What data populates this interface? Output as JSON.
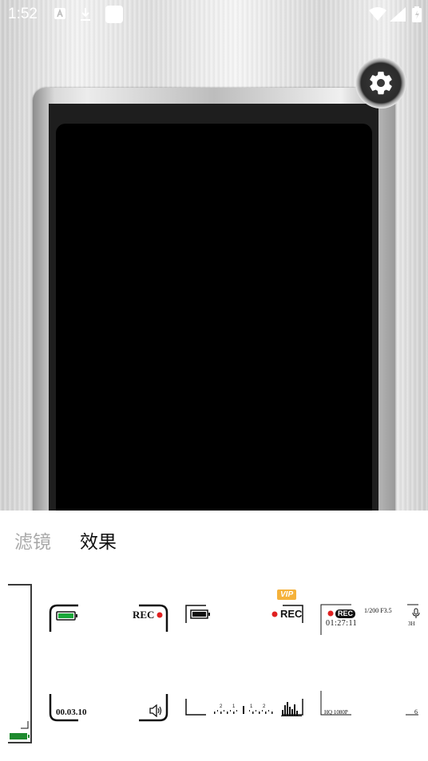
{
  "status_bar": {
    "time": "1:52",
    "icons": [
      "a-notification-icon",
      "download-icon",
      "square-app-icon",
      "wifi-icon",
      "signal-icon",
      "battery-icon"
    ]
  },
  "tabs": [
    {
      "label": "滤镜",
      "active": false
    },
    {
      "label": "效果",
      "active": true
    }
  ],
  "effects": {
    "vip_label": "VIP",
    "card1": {
      "rec": "REC",
      "timestamp": "00.03.10"
    },
    "card2": {
      "rec": "REC",
      "ruler": "2 1 1"
    },
    "card3": {
      "rec": "REC",
      "timecode": "01:27:11",
      "shutter": "1/200 F3.5",
      "quality": "HQ 1080P",
      "right_top": "3H",
      "right_bottom": "6"
    }
  },
  "colors": {
    "accent_vip": "#f5b23b",
    "rec_dot": "#e02020",
    "tab_active": "#111111",
    "tab_inactive": "#a9a9a9"
  }
}
